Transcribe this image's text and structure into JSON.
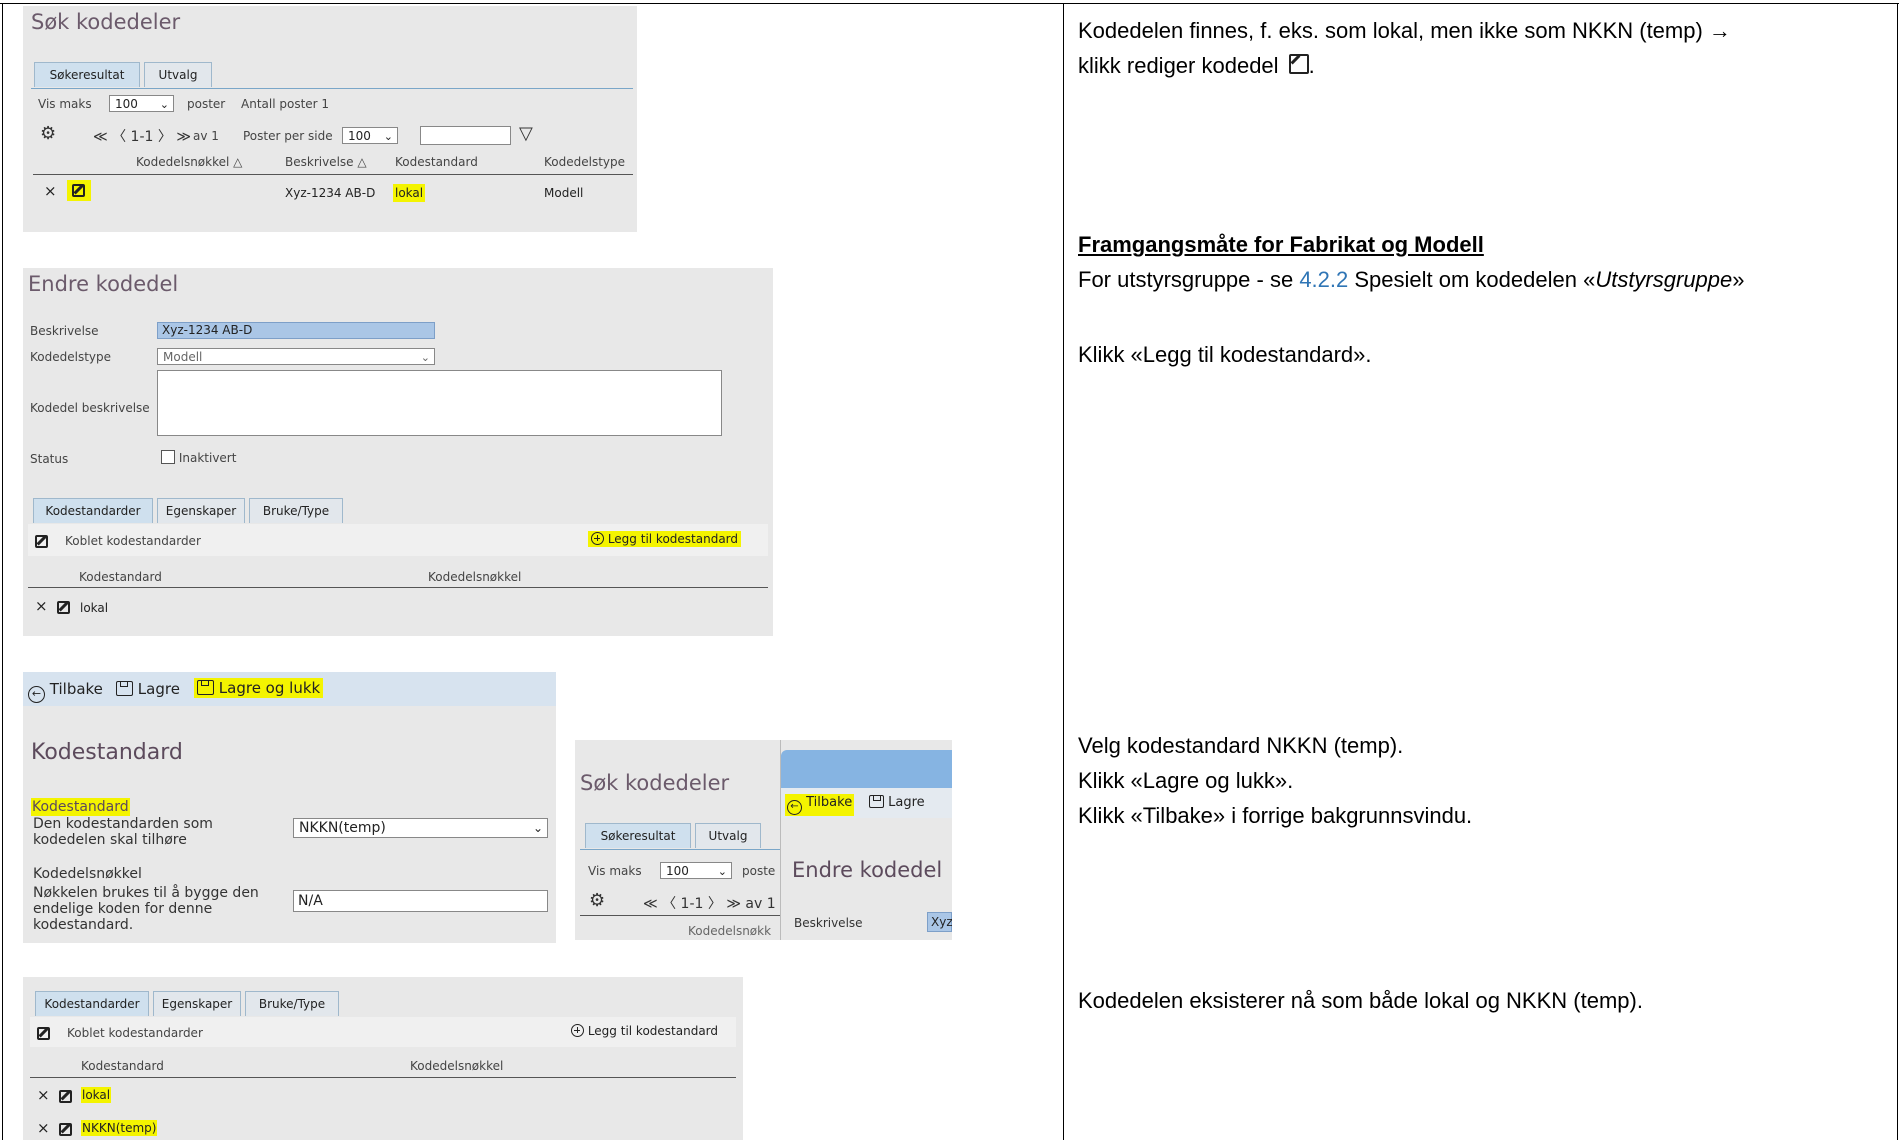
{
  "shot1": {
    "title": "Søk kodedeler",
    "tabs": [
      "Søkeresultat",
      "Utvalg"
    ],
    "vis_maks": "Vis maks",
    "vis_maks_value": "100",
    "poster": "poster",
    "antall": "Antall poster 1",
    "pager": "≪ 〈 1-1 〉 ≫",
    "av": "av 1",
    "per_side": "Poster per side",
    "per_side_value": "100",
    "columns": [
      "Kodedelsnøkkel △",
      "Beskrivelse △",
      "Kodestandard",
      "Kodedelstype"
    ],
    "row": {
      "x": "×",
      "beskrivelse": "Xyz-1234 AB-D",
      "kodestandard": "lokal",
      "type": "Modell"
    }
  },
  "shot2": {
    "title": "Endre kodedel",
    "beskrivelse_label": "Beskrivelse",
    "beskrivelse_value": "Xyz-1234 AB-D",
    "type_label": "Kodedelstype",
    "type_value": "Modell",
    "kb_label": "Kodedel beskrivelse",
    "status_label": "Status",
    "inaktivert": "Inaktivert",
    "tabs": [
      "Kodestandarder",
      "Egenskaper",
      "Bruke/Type"
    ],
    "koblet": "Koblet kodestandarder",
    "legg_til": "Legg til kodestandard",
    "col_kodestandard": "Kodestandard",
    "col_nokkel": "Kodedelsnøkkel",
    "row_x": "×",
    "row": "lokal"
  },
  "shot3": {
    "tilbake": "Tilbake",
    "lagre": "Lagre",
    "lagre_lukk": "Lagre og lukk",
    "title": "Kodestandard",
    "ks_label": "Kodestandard",
    "ks_help": "Den kodestandarden som kodedelen skal tilhøre",
    "ks_value": "NKKN(temp)",
    "nokkel_label": "Kodedelsnøkkel",
    "nokkel_help": "Nøkkelen brukes til å bygge den endelige koden for denne kodestandard.",
    "nokkel_value": "N/A"
  },
  "shot4": {
    "title": "Søk kodedeler",
    "tabs": [
      "Søkeresultat",
      "Utvalg"
    ],
    "vis_maks": "Vis maks",
    "vis_maks_value": "100",
    "poste": "poste",
    "pager": "≪ 〈 1-1 〉 ≫ av 1",
    "kodedelsnokk": "Kodedelsnøkk",
    "tilbake": "Tilbake",
    "lagre": "Lagre",
    "endre": "Endre kodedel",
    "beskrivelse": "Beskrivelse",
    "xyz": "Xyz"
  },
  "shot5": {
    "tabs": [
      "Kodestandarder",
      "Egenskaper",
      "Bruke/Type"
    ],
    "koblet": "Koblet kodestandarder",
    "legg_til": "Legg til kodestandard",
    "col_kodestandard": "Kodestandard",
    "col_nokkel": "Kodedelsnøkkel",
    "row_x": "×",
    "rows": [
      "lokal",
      "NKKN(temp)"
    ]
  },
  "right": {
    "p1_line1": "Kodedelen finnes, f. eks. som lokal, men ikke som NKKN (temp) →",
    "p1_line2": "klikk rediger kodedel",
    "p1_end": ".",
    "heading": "Framgangsmåte for Fabrikat og Modell",
    "p2_a": "For utstyrsgruppe - se ",
    "p2_link": "4.2.2",
    "p2_b": " Spesielt om kodedelen «",
    "p2_italic": "Utstyrsgruppe",
    "p2_c": "»",
    "p3": "Klikk «Legg til kodestandard».",
    "p4_1": "Velg kodestandard NKKN (temp).",
    "p4_2": "Klikk «Lagre og lukk».",
    "p4_3": "Klikk «Tilbake» i forrige bakgrunnsvindu.",
    "p5": "Kodedelen eksisterer nå som både lokal og NKKN (temp)."
  }
}
